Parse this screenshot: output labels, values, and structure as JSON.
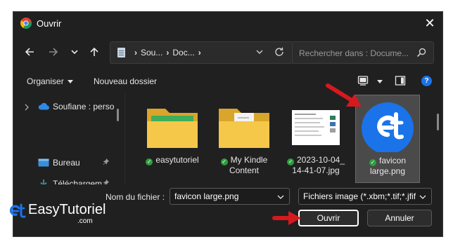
{
  "window": {
    "title": "Ouvrir",
    "close_glyph": "✕"
  },
  "nav": {
    "breadcrumb": [
      "Sou...",
      "Doc..."
    ],
    "search_placeholder": "Rechercher dans : Docume..."
  },
  "toolbar": {
    "organize": "Organiser",
    "new_folder": "Nouveau dossier",
    "help": "?"
  },
  "sidebar": {
    "items": [
      {
        "label": "Soufiane : perso",
        "icon": "cloud-icon"
      },
      {
        "label": "Bureau",
        "icon": "desktop-icon"
      },
      {
        "label": "Téléchargem",
        "icon": "download-icon"
      }
    ]
  },
  "files": [
    {
      "name": "easytutoriel",
      "kind": "folder"
    },
    {
      "name": "My Kindle Content",
      "kind": "folder"
    },
    {
      "name": "2023-10-04_14-41-07.jpg",
      "line1": "2023-10-04_",
      "line2": "14-41-07.jpg",
      "kind": "image"
    },
    {
      "name": "favicon large.png",
      "line1": "favicon",
      "line2": "large.png",
      "kind": "image",
      "selected": true
    }
  ],
  "footer": {
    "filename_label": "Nom du fichier :",
    "filename_value": "favicon large.png",
    "filetype_value": "Fichiers image (*.xbm;*.tif;*.jfif;",
    "open_label": "Ouvrir",
    "cancel_label": "Annuler"
  },
  "brand": {
    "name": "EasyTutoriel",
    "suffix": ".com"
  },
  "colors": {
    "accent": "#1a73e8",
    "annotation_arrow": "#d6191e",
    "window_bg": "#202020"
  }
}
